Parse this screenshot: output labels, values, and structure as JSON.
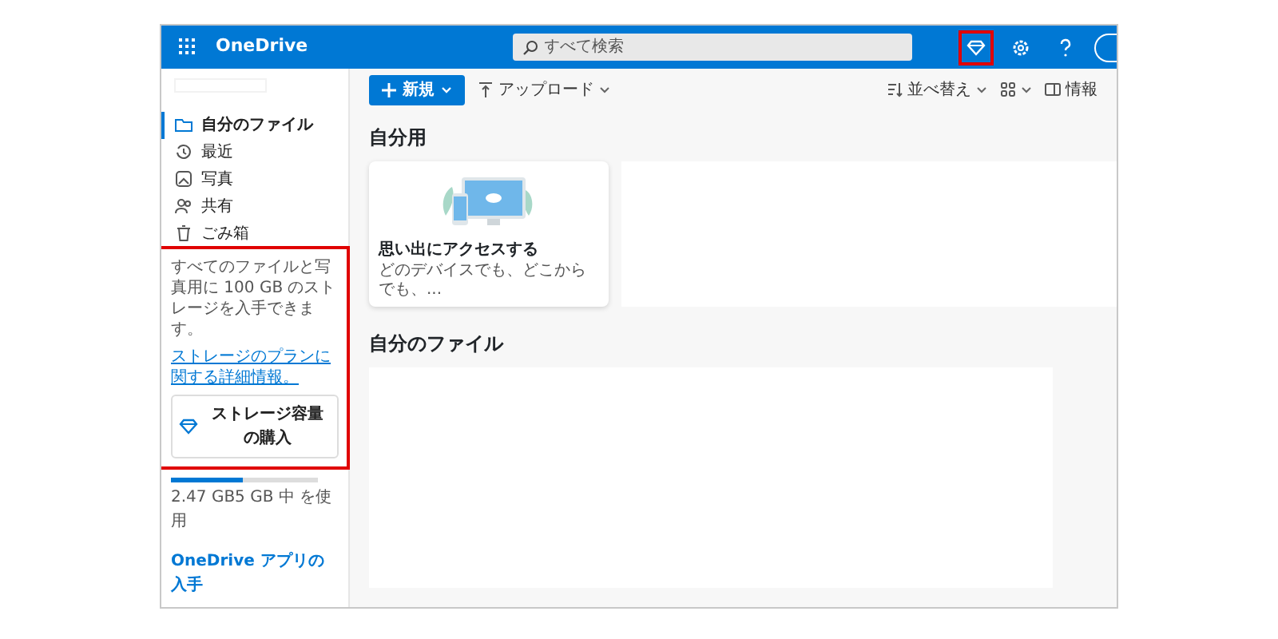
{
  "header": {
    "app_name": "OneDrive",
    "search": {
      "placeholder": "すべて検索"
    },
    "premium_button": {
      "highlighted": true
    }
  },
  "toolbar": {
    "new_button": "新規",
    "upload_button": "アップロード",
    "sort_button": "並べ替え",
    "info_button": "情報"
  },
  "sidebar": {
    "items": [
      {
        "label": "自分のファイル",
        "selected": true
      },
      {
        "label": "最近",
        "selected": false
      },
      {
        "label": "写真",
        "selected": false
      },
      {
        "label": "共有",
        "selected": false
      },
      {
        "label": "ごみ箱",
        "selected": false
      }
    ],
    "promo": {
      "highlighted": true,
      "text": "すべてのファイルと写真用に 100 GB のストレージを入手できます。",
      "link": "ストレージのプランに関する詳細情報。",
      "button": "ストレージ容量の購入"
    },
    "storage": {
      "level": 0.49,
      "text": "2.47 GB5 GB 中 を使用"
    },
    "get_app_link": "OneDrive アプリの入手"
  },
  "sections": [
    {
      "title": "自分用",
      "cards": [
        {
          "title": "思い出にアクセスする",
          "subtitle": "どのデバイスでも、どこからでも、..."
        }
      ]
    },
    {
      "title": "自分のファイル"
    }
  ]
}
